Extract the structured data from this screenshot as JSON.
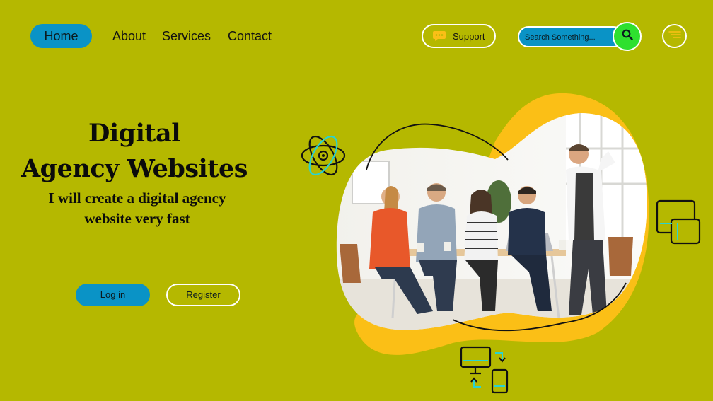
{
  "nav": {
    "home_label": "Home",
    "links": [
      "About",
      "Services",
      "Contact"
    ],
    "support_label": "Support"
  },
  "search": {
    "placeholder": "Search Something..."
  },
  "hero": {
    "title_line1": "Digital",
    "title_line2": "Agency Websites",
    "subtitle_line1": "I will create a digital agency",
    "subtitle_line2": "website very fast",
    "login_label": "Log in",
    "register_label": "Register"
  },
  "icons": [
    "chat-icon",
    "search-icon",
    "menu-icon",
    "atom-icon",
    "devices-icon",
    "sync-devices-icon"
  ],
  "colors": {
    "background": "#b5b800",
    "accent_blue": "#0a93c6",
    "search_green": "#2fe02f",
    "blob_yellow": "#fbbf16",
    "line_teal": "#2bd3d0"
  }
}
